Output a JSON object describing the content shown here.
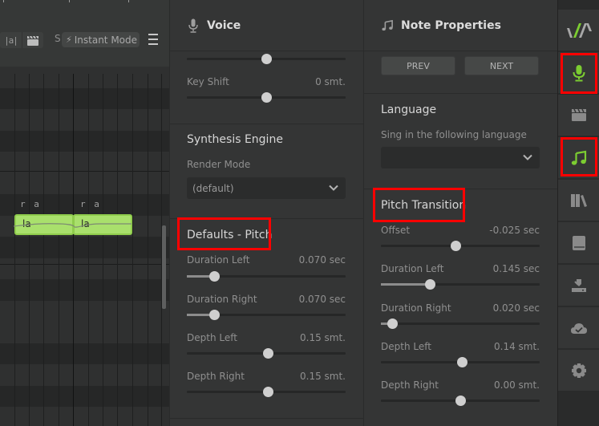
{
  "toolbar": {
    "lyric_button_label": "|a|",
    "s_label": "S",
    "instant_mode_label": "Instant Mode",
    "icons": [
      "lyric-mode-icon",
      "clapper-icon",
      "lightning-icon",
      "hamburger-menu-icon"
    ]
  },
  "piano_roll": {
    "notes": [
      {
        "lyric": "la",
        "phoneme": "r a"
      },
      {
        "lyric": "la",
        "phoneme": "r a"
      }
    ]
  },
  "voice_panel": {
    "title": "Voice",
    "icon": "microphone-icon",
    "top_slider": {
      "value_fraction": 0.5
    },
    "key_shift": {
      "label": "Key Shift",
      "value": "0 smt.",
      "value_fraction": 0.5
    },
    "synthesis_engine": {
      "title": "Synthesis Engine",
      "render_mode_label": "Render Mode",
      "render_mode_value": "(default)"
    },
    "defaults_pitch": {
      "title": "Defaults - Pitch",
      "rows": [
        {
          "label": "Duration Left",
          "value": "0.070 sec",
          "value_fraction": 0.17
        },
        {
          "label": "Duration Right",
          "value": "0.070 sec",
          "value_fraction": 0.17
        },
        {
          "label": "Depth Left",
          "value": "0.15 smt.",
          "value_fraction": 0.51
        },
        {
          "label": "Depth Right",
          "value": "0.15 smt.",
          "value_fraction": 0.51
        }
      ]
    }
  },
  "note_panel": {
    "title": "Note Properties",
    "icon": "music-note-icon",
    "prev_label": "PREV",
    "next_label": "NEXT",
    "language": {
      "title": "Language",
      "subtitle": "Sing in the following language",
      "value": ""
    },
    "pitch_transition": {
      "title": "Pitch Transition",
      "rows": [
        {
          "label": "Offset",
          "value": "-0.025 sec",
          "value_fraction": 0.47
        },
        {
          "label": "Duration Left",
          "value": "0.145 sec",
          "value_fraction": 0.31
        },
        {
          "label": "Duration Right",
          "value": "0.020 sec",
          "value_fraction": 0.07
        },
        {
          "label": "Depth Left",
          "value": "0.14 smt.",
          "value_fraction": 0.51
        },
        {
          "label": "Depth Right",
          "value": "0.00 smt.",
          "value_fraction": 0.5
        }
      ]
    }
  },
  "sidebar": {
    "items": [
      {
        "name": "logo-icon",
        "active": false
      },
      {
        "name": "voice-microphone-icon",
        "active": true
      },
      {
        "name": "clapper-icon",
        "active": false
      },
      {
        "name": "music-note-icon",
        "active": true
      },
      {
        "name": "library-icon",
        "active": false
      },
      {
        "name": "book-icon",
        "active": false
      },
      {
        "name": "render-export-icon",
        "active": false
      },
      {
        "name": "cloud-check-icon",
        "active": false
      },
      {
        "name": "settings-gear-icon",
        "active": false
      }
    ]
  },
  "colors": {
    "accent_green": "#7ccd31",
    "note_fill": "#a9e06c",
    "highlight_red": "#ff0000"
  }
}
